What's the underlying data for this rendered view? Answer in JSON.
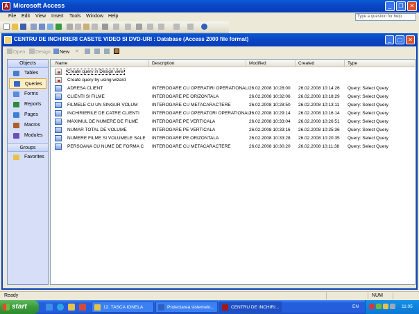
{
  "app": {
    "title": "Microsoft Access",
    "logo": "A"
  },
  "menu": [
    "File",
    "Edit",
    "View",
    "Insert",
    "Tools",
    "Window",
    "Help"
  ],
  "help_box": {
    "placeholder": "Type a question for help"
  },
  "db_window": {
    "title": "CENTRU DE INCHIRIERI CASETE VIDEO SI DVD-URI : Database (Access 2000 file format)",
    "toolbar": {
      "open": "Open",
      "design": "Design",
      "new": "New"
    }
  },
  "objects": {
    "header": "Objects",
    "items": [
      {
        "label": "Tables",
        "color": "#4a7bd0"
      },
      {
        "label": "Queries",
        "color": "#3a66c4"
      },
      {
        "label": "Forms",
        "color": "#5a8ad8"
      },
      {
        "label": "Reports",
        "color": "#2f8a3e"
      },
      {
        "label": "Pages",
        "color": "#3f7fcf"
      },
      {
        "label": "Macros",
        "color": "#b05f2a"
      },
      {
        "label": "Modules",
        "color": "#6a4fb8"
      }
    ],
    "groups_header": "Groups",
    "favorites": "Favorites"
  },
  "list": {
    "columns": [
      "Name",
      "Description",
      "Modified",
      "Created",
      "Type"
    ],
    "wizards": [
      "Create query in Design view",
      "Create query by using wizard"
    ],
    "rows": [
      {
        "name": "ADRESA CLIENT",
        "description": "INTEROGARE CU OPERATIRI OPERATIONALI",
        "modified": "26.02.2008 10:28:00",
        "created": "26.02.2008 10:14:26",
        "type": "Query: Select Query"
      },
      {
        "name": "CLIENTI SI FILME",
        "description": "INTEROGARE PE ORIZONTALA",
        "modified": "26.02.2008 10:32:06",
        "created": "26.02.2008 10:18:29",
        "type": "Query: Select Query"
      },
      {
        "name": "FILMELE CU UN SINGUR VOLUM",
        "description": "INTEROGARE CU METACARACTERE",
        "modified": "26.02.2008 10:28:50",
        "created": "26.02.2008 10:13:11",
        "type": "Query: Select Query"
      },
      {
        "name": "INCHIRIERILE DE CATRE CLIENTI",
        "description": "INTEROGARE CU OPERATORI OPERATIONALI",
        "modified": "26.02.2008 10:29:14",
        "created": "26.02.2008 10:16:14",
        "type": "Query: Select Query"
      },
      {
        "name": "MAXIMUL DE NUMERE DE FILME",
        "description": "INTEROGARE PE VERTICALA",
        "modified": "26.02.2008 10:33:04",
        "created": "26.02.2008 10:26:51",
        "type": "Query: Select Query"
      },
      {
        "name": "NUMAR TOTAL DE VOLUME",
        "description": "INTEROGARE PE VERTICALA",
        "modified": "26.02.2008 10:33:16",
        "created": "26.02.2008 10:25:36",
        "type": "Query: Select Query"
      },
      {
        "name": "NUMERE FILME SI VOLUMELE SALE",
        "description": "INTEROGARE PE ORIZONTALA",
        "modified": "26.02.2008 10:33:28",
        "created": "26.02.2008 10:20:35",
        "type": "Query: Select Query"
      },
      {
        "name": "PERSOANA CU NUME DE FORMA C",
        "description": "INTEROGARE CU METACARACTERE",
        "modified": "26.02.2008 10:30:20",
        "created": "26.02.2008 10:11:38",
        "type": "Query: Select Query"
      }
    ]
  },
  "status": {
    "text": "Ready",
    "num": "NUM"
  },
  "taskbar": {
    "start": "start",
    "tasks": [
      "12. TASCA IONELA",
      "Proiectarea sistemelo...",
      "CENTRU DE INCHIRI..."
    ],
    "lang": "EN",
    "clock": "11:05"
  }
}
